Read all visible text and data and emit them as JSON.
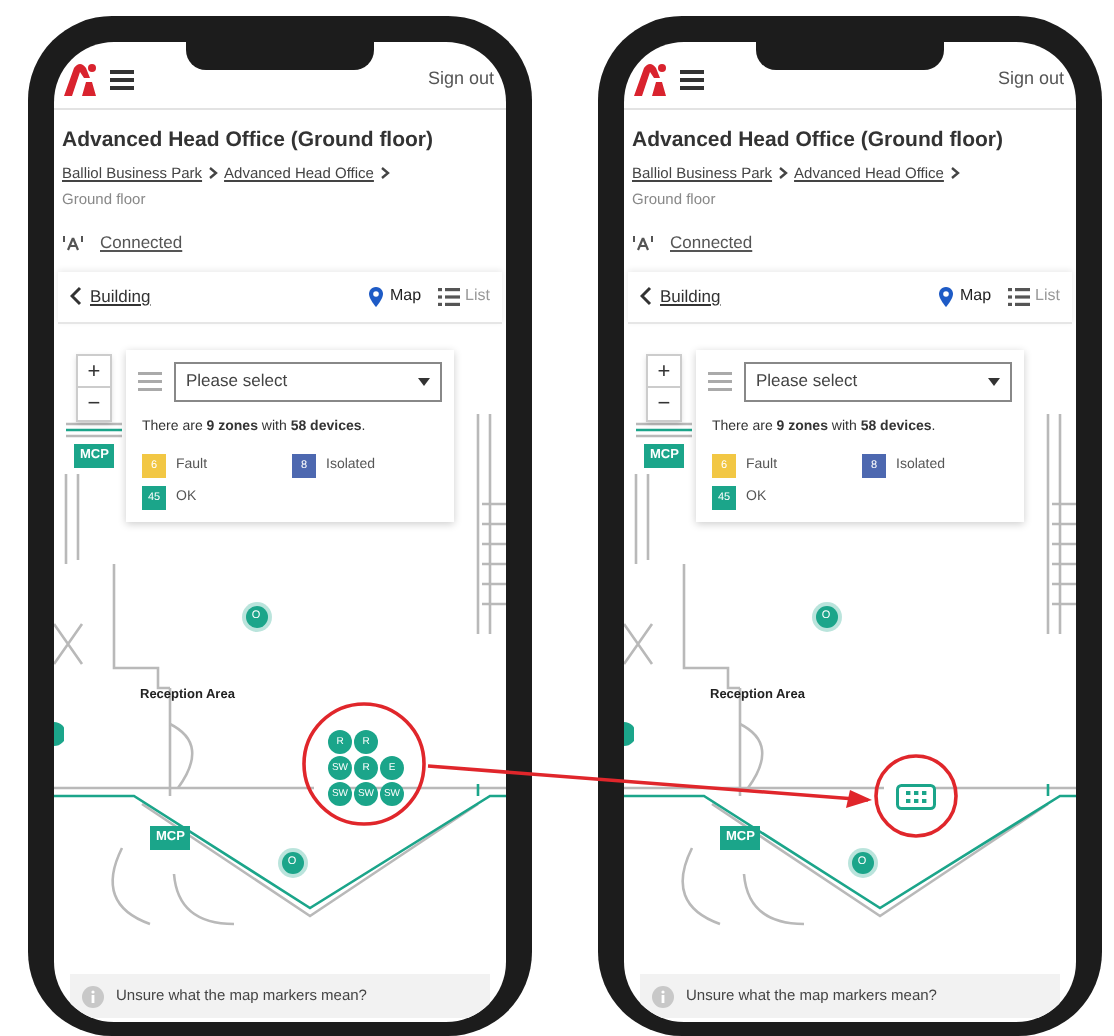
{
  "phones": [
    {
      "sign_out": "Sign out",
      "title": "Advanced Head Office (Ground floor)",
      "breadcrumbs": [
        {
          "label": "Balliol Business Park",
          "link": true
        },
        {
          "label": "Advanced Head Office",
          "link": true
        },
        {
          "label": "Ground floor",
          "link": false
        }
      ],
      "connection": "Connected",
      "back": "Building",
      "views": [
        {
          "label": "Map",
          "selected": true
        },
        {
          "label": "List",
          "selected": false
        }
      ],
      "zoom_buttons": [
        "+",
        "−"
      ],
      "zone_select": {
        "placeholder": "Please select"
      },
      "summary": "There are **9 zones** with **58 devices**.",
      "legend": [
        {
          "count": "6",
          "label": "Fault",
          "color": "#f2c744"
        },
        {
          "count": "8",
          "label": "Isolated",
          "color": "#4d68b0"
        },
        {
          "count": "45",
          "label": "OK",
          "color": "#1ba58a"
        }
      ],
      "room_label": "Reception Area",
      "tags": [
        "MCP",
        "MCP"
      ],
      "devices": [
        {
          "label": "O"
        },
        {
          "label": "O"
        }
      ],
      "cluster": {
        "kind": "expanded",
        "labels": [
          "R",
          "R",
          "SW",
          "R",
          "E",
          "SW",
          "SW",
          "SW"
        ]
      },
      "help": "Unsure what the map markers mean?"
    },
    {
      "sign_out": "Sign out",
      "title": "Advanced Head Office (Ground floor)",
      "breadcrumbs": [
        {
          "label": "Balliol Business Park",
          "link": true
        },
        {
          "label": "Advanced Head Office",
          "link": true
        },
        {
          "label": "Ground floor",
          "link": false
        }
      ],
      "connection": "Connected",
      "back": "Building",
      "views": [
        {
          "label": "Map",
          "selected": true
        },
        {
          "label": "List",
          "selected": false
        }
      ],
      "zoom_buttons": [
        "+",
        "−"
      ],
      "zone_select": {
        "placeholder": "Please select"
      },
      "summary": "There are **9 zones** with **58 devices**.",
      "legend": [
        {
          "count": "6",
          "label": "Fault",
          "color": "#f2c744"
        },
        {
          "count": "8",
          "label": "Isolated",
          "color": "#4d68b0"
        },
        {
          "count": "45",
          "label": "OK",
          "color": "#1ba58a"
        }
      ],
      "room_label": "Reception Area",
      "tags": [
        "MCP",
        "MCP"
      ],
      "devices": [
        {
          "label": "O"
        },
        {
          "label": "O"
        }
      ],
      "cluster": {
        "kind": "collapsed"
      },
      "help": "Unsure what the map markers mean?"
    }
  ]
}
